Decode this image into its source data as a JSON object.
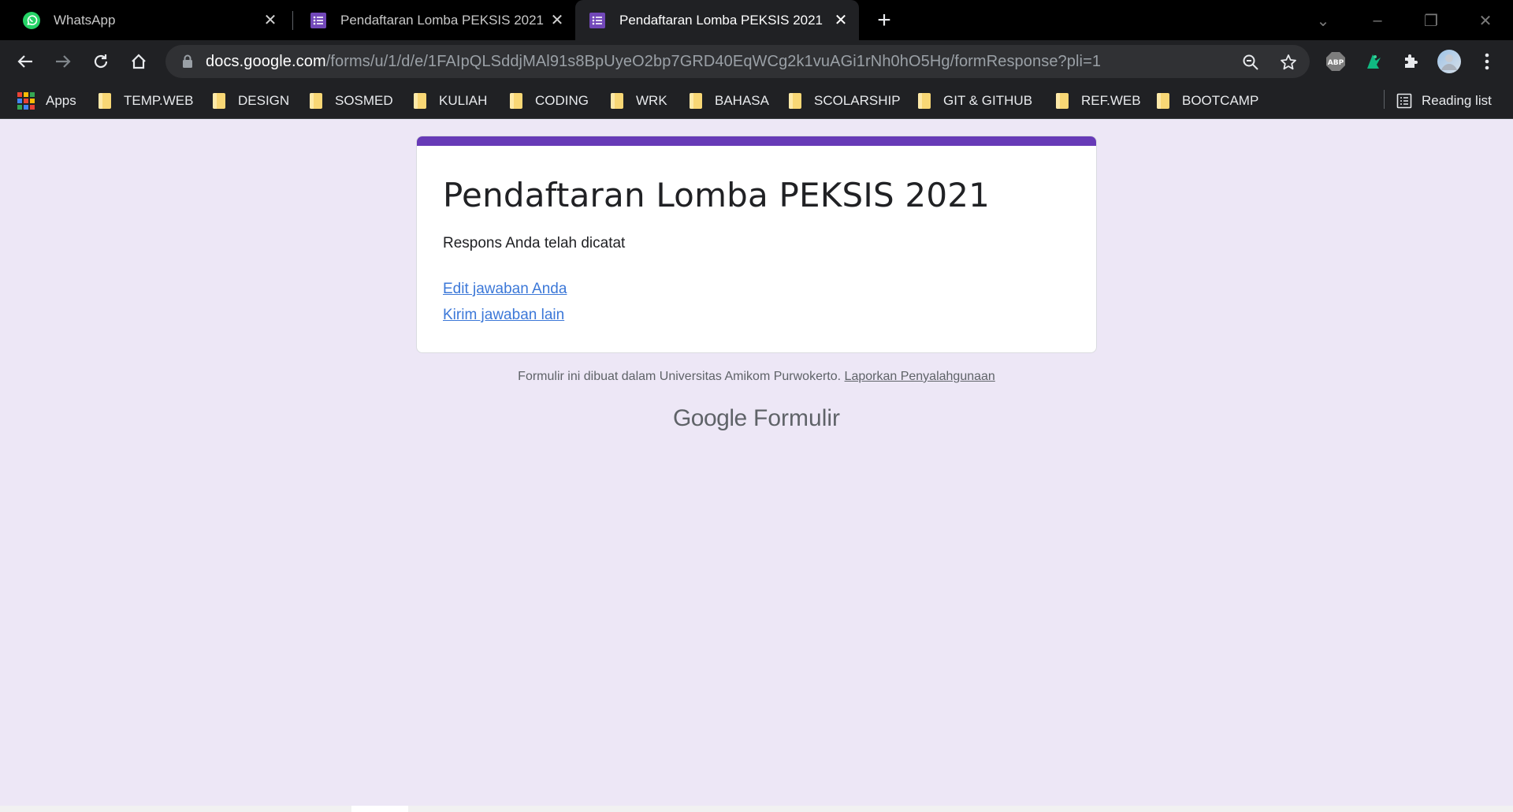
{
  "browser": {
    "tabs": [
      {
        "title": "WhatsApp",
        "icon": "whatsapp-icon",
        "active": false
      },
      {
        "title": "Pendaftaran Lomba PEKSIS 2021",
        "icon": "google-forms-icon",
        "active": false
      },
      {
        "title": "Pendaftaran Lomba PEKSIS 2021",
        "icon": "google-forms-icon",
        "active": true
      }
    ],
    "url_host": "docs.google.com",
    "url_path": "/forms/u/1/d/e/1FAIpQLSddjMAl91s8BpUyeO2bp7GRD40EqWCg2k1vuAGi1rNh0hO5Hg/formResponse?pli=1",
    "bookmarks": {
      "apps_label": "Apps",
      "folders": [
        "TEMP.WEB",
        "DESIGN",
        "SOSMED",
        "KULIAH",
        "CODING",
        "WRK",
        "BAHASA",
        "SCOLARSHIP",
        "GIT & GITHUB",
        "REF.WEB",
        "BOOTCAMP"
      ],
      "reading_list_label": "Reading list"
    },
    "extensions": [
      "adblock-plus-icon",
      "green-extension-icon",
      "puzzle-icon",
      "profile-avatar"
    ]
  },
  "form": {
    "title": "Pendaftaran Lomba PEKSIS 2021",
    "confirmation": "Respons Anda telah dicatat",
    "edit_link": "Edit jawaban Anda",
    "resubmit_link": "Kirim jawaban lain",
    "accent_color": "#673ab7"
  },
  "footer": {
    "note": "Formulir ini dibuat dalam Universitas Amikom Purwokerto.",
    "report_link": "Laporkan Penyalahgunaan",
    "brand_google": "Google",
    "brand_product": "Formulir"
  }
}
